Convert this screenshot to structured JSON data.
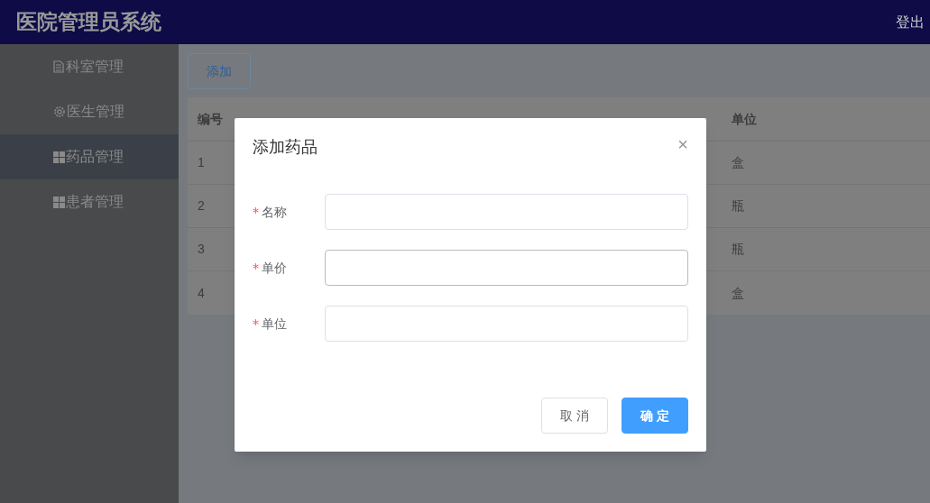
{
  "header": {
    "title": "医院管理员系统",
    "logout": "登出"
  },
  "sidebar": {
    "items": [
      {
        "label": "科室管理",
        "kind": "document",
        "selected": false
      },
      {
        "label": "医生管理",
        "kind": "gear",
        "selected": false
      },
      {
        "label": "药品管理",
        "kind": "grid",
        "selected": true
      },
      {
        "label": "患者管理",
        "kind": "grid",
        "selected": false
      }
    ]
  },
  "add_button": "添加",
  "table": {
    "columns": [
      "编号",
      "单位"
    ],
    "rows": [
      [
        "1",
        "盒"
      ],
      [
        "2",
        "瓶"
      ],
      [
        "3",
        "瓶"
      ],
      [
        "4",
        "盒"
      ]
    ]
  },
  "dialog": {
    "title": "添加药品",
    "close": "×",
    "fields": [
      {
        "label": "名称",
        "required": true,
        "hovered": false
      },
      {
        "label": "单价",
        "required": true,
        "hovered": true
      },
      {
        "label": "单位",
        "required": true,
        "hovered": false
      }
    ],
    "buttons": [
      {
        "label": "取 消",
        "kind": "default"
      },
      {
        "label": "确 定",
        "kind": "primary"
      }
    ]
  }
}
